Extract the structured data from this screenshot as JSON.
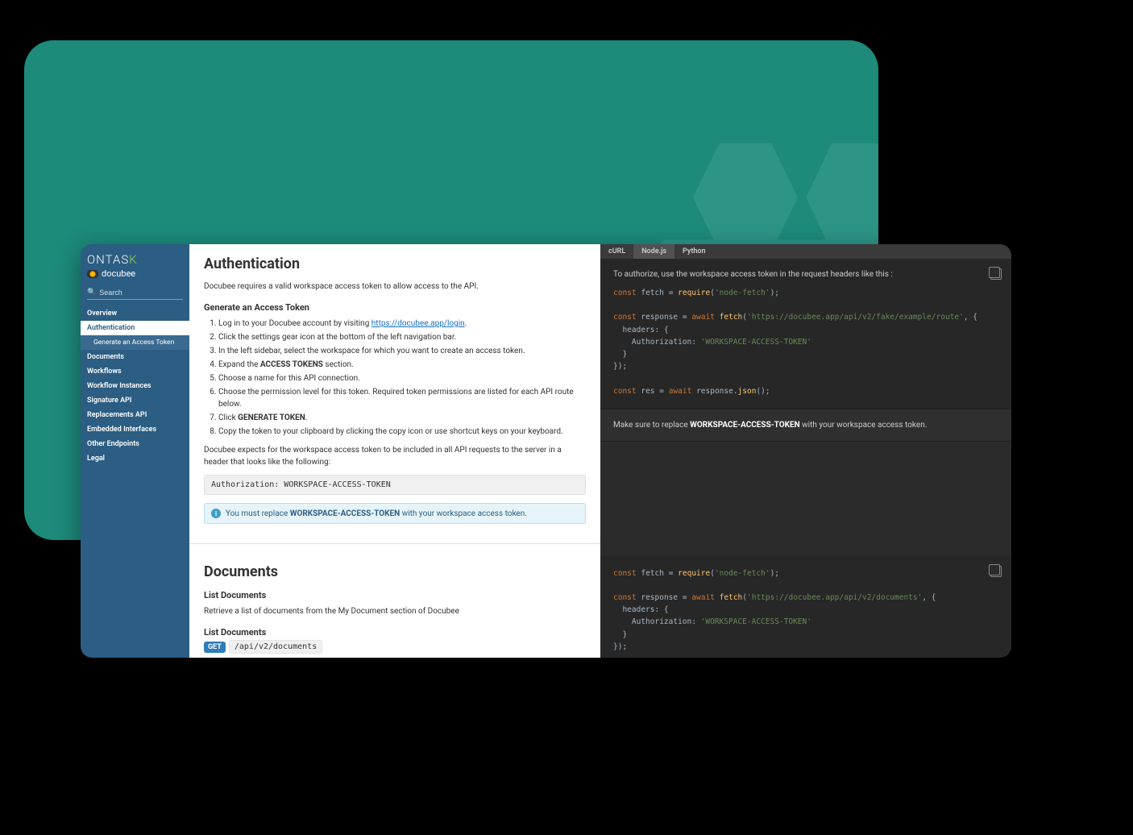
{
  "sidebar": {
    "brand_main": "ONTASK",
    "brand_sub": "docubee",
    "search_placeholder": "Search",
    "items": [
      {
        "label": "Overview"
      },
      {
        "label": "Authentication",
        "active": true,
        "sub": "Generate an Access Token"
      },
      {
        "label": "Documents"
      },
      {
        "label": "Workflows"
      },
      {
        "label": "Workflow Instances"
      },
      {
        "label": "Signature API"
      },
      {
        "label": "Replacements API"
      },
      {
        "label": "Embedded Interfaces"
      },
      {
        "label": "Other Endpoints"
      },
      {
        "label": "Legal"
      }
    ]
  },
  "main": {
    "auth": {
      "title": "Authentication",
      "intro": "Docubee requires a valid workspace access token to allow access to the API.",
      "generate_heading": "Generate an Access Token",
      "step1_a": "Log in to your Docubee account by visiting ",
      "step1_link": "https://docubee.app/login",
      "step1_b": ".",
      "step2": "Click the settings gear icon at the bottom of the left navigation bar.",
      "step3": "In the left sidebar, select the workspace for which you want to create an access token.",
      "step4_a": "Expand the ",
      "step4_bold": "ACCESS TOKENS",
      "step4_b": " section.",
      "step5": "Choose a name for this API connection.",
      "step6": "Choose the permission level for this token. Required token permissions are listed for each API route below.",
      "step7_a": "Click ",
      "step7_bold": "GENERATE TOKEN",
      "step7_b": ".",
      "step8": "Copy the token to your clipboard by clicking the copy icon or use shortcut keys on your keyboard.",
      "expects": "Docubee expects for the workspace access token to be included in all API requests to the server in a header that looks like the following:",
      "header_example": "Authorization: WORKSPACE-ACCESS-TOKEN",
      "info_a": "You must replace ",
      "info_bold": "WORKSPACE-ACCESS-TOKEN",
      "info_b": " with your workspace access token."
    },
    "docs": {
      "title": "Documents",
      "list_heading": "List Documents",
      "list_desc": "Retrieve a list of documents from the My Document section of Docubee",
      "list_heading2": "List Documents",
      "method": "GET",
      "path": "/api/v2/documents"
    }
  },
  "code": {
    "tabs": [
      "cURL",
      "Node.js",
      "Python"
    ],
    "active_tab": "Node.js",
    "authorize_note": "To authorize, use the workspace access token in the request headers like this :",
    "snippet1_url": "'https://docubee.app/api/v2/fake/example/route'",
    "snippet2_url": "'https://docubee.app/api/v2/documents'",
    "require_str": "'node-fetch'",
    "token_str": "'WORKSPACE-ACCESS-TOKEN'",
    "replace_note_a": "Make sure to replace ",
    "replace_note_bold": "WORKSPACE-ACCESS-TOKEN",
    "replace_note_b": " with your workspace access token."
  }
}
